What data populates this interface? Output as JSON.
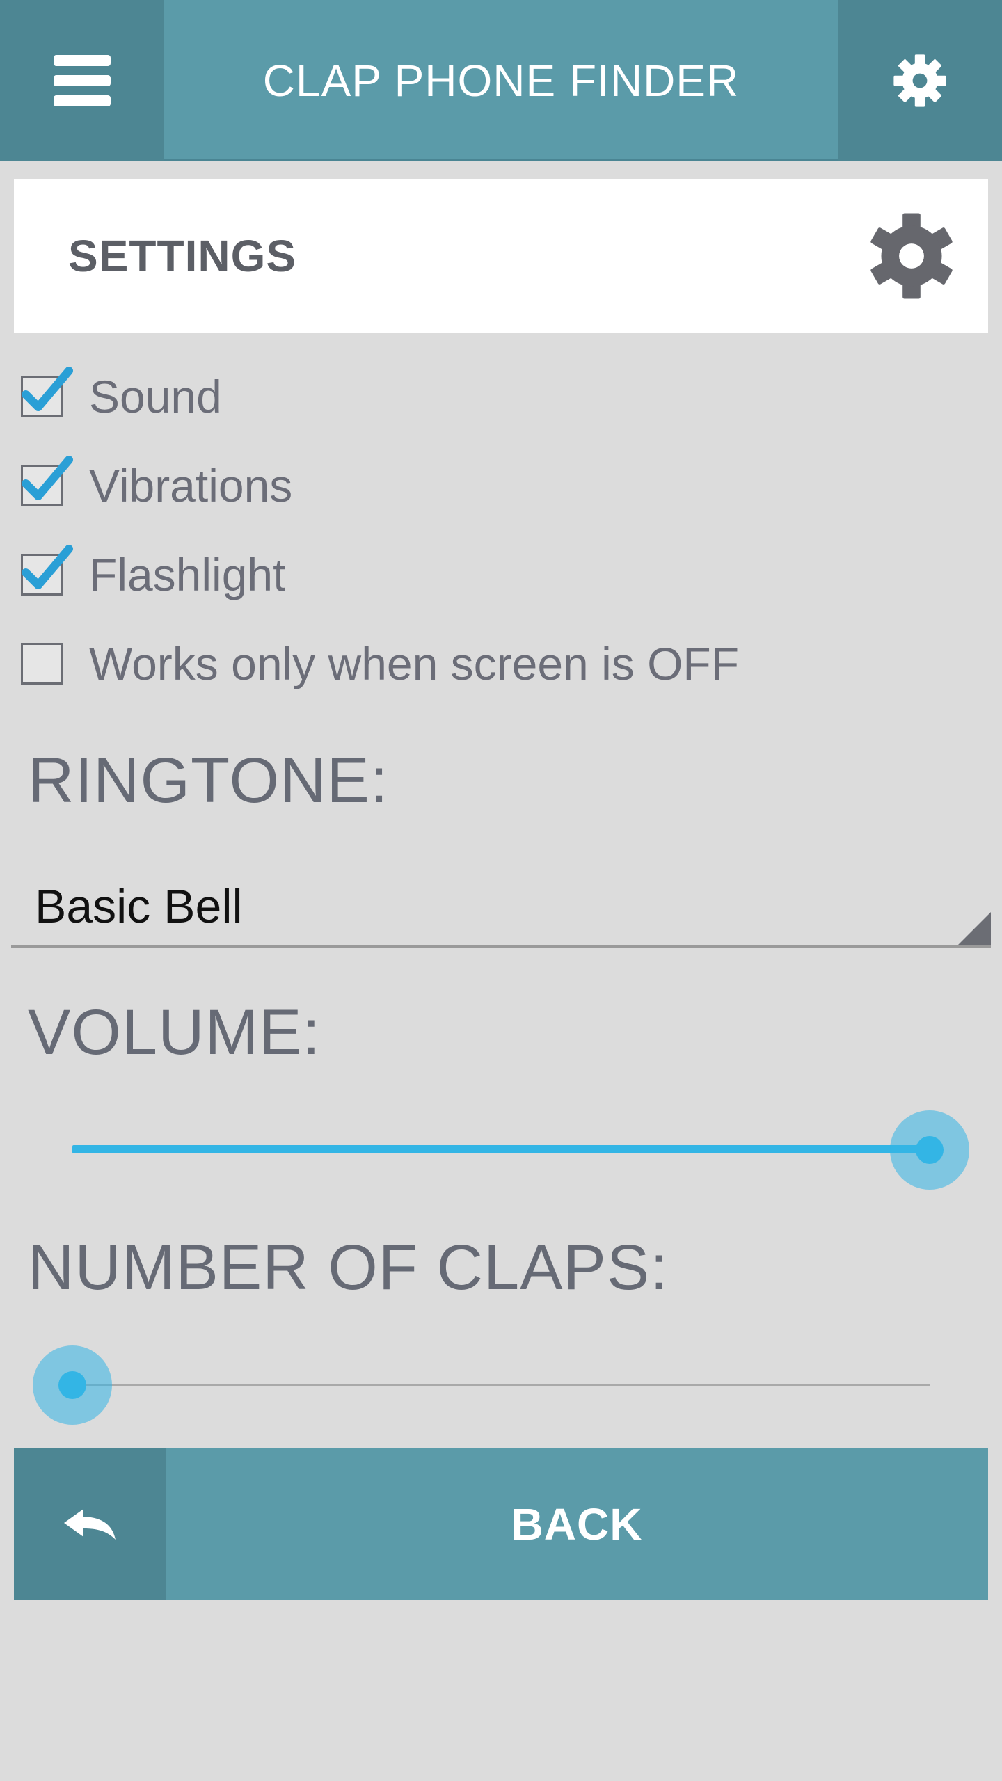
{
  "app": {
    "title": "CLAP PHONE FINDER"
  },
  "header": {
    "section_title": "SETTINGS"
  },
  "options": [
    {
      "label": "Sound",
      "checked": true
    },
    {
      "label": "Vibrations",
      "checked": true
    },
    {
      "label": "Flashlight",
      "checked": true
    },
    {
      "label": "Works only when screen is OFF",
      "checked": false
    }
  ],
  "ringtone": {
    "label": "RINGTONE:",
    "selected": "Basic Bell"
  },
  "volume": {
    "label": "VOLUME:",
    "level": 1.0
  },
  "claps": {
    "label": "NUMBER OF CLAPS:",
    "level": 0.0
  },
  "back": {
    "label": "BACK"
  },
  "icons": {
    "menu": "hamburger-menu-icon",
    "settings": "gear-icon",
    "back": "reply-arrow-icon"
  },
  "colors": {
    "primary": "#5b9ba9",
    "primary_dark": "#4d8693",
    "accent": "#33b5e5",
    "background": "#dcdcdc"
  }
}
